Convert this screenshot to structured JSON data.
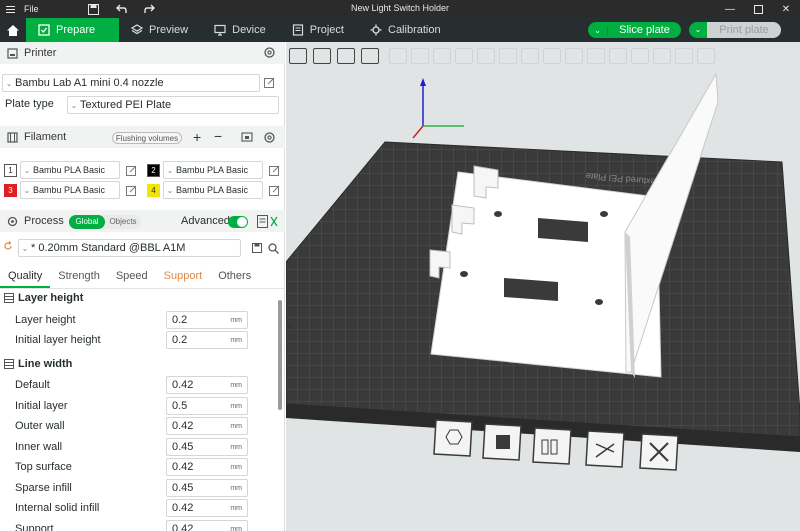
{
  "window": {
    "file_menu": "File",
    "title": "New Light Switch Holder"
  },
  "tabs": [
    {
      "label": "Prepare"
    },
    {
      "label": "Preview"
    },
    {
      "label": "Device"
    },
    {
      "label": "Project"
    },
    {
      "label": "Calibration"
    }
  ],
  "actions": {
    "slice": "Slice plate",
    "print": "Print plate"
  },
  "printer": {
    "section": "Printer",
    "name": "Bambu Lab A1 mini 0.4 nozzle",
    "plate_type_label": "Plate type",
    "plate_type": "Textured PEI Plate"
  },
  "filament": {
    "section": "Filament",
    "flushing": "Flushing volumes",
    "slots": [
      {
        "num": "1",
        "name": "Bambu PLA Basic",
        "color": "#ffffff"
      },
      {
        "num": "2",
        "name": "Bambu PLA Basic",
        "color": "#000000"
      },
      {
        "num": "3",
        "name": "Bambu PLA Basic",
        "color": "#e02020"
      },
      {
        "num": "4",
        "name": "Bambu PLA Basic",
        "color": "#f2e600"
      }
    ]
  },
  "process": {
    "section": "Process",
    "global": "Global",
    "objects": "Objects",
    "advanced": "Advanced",
    "preset": "* 0.20mm Standard @BBL A1M",
    "tabs": [
      "Quality",
      "Strength",
      "Speed",
      "Support",
      "Others"
    ],
    "groups": {
      "layer_height": {
        "title": "Layer height",
        "rows": [
          {
            "label": "Layer height",
            "value": "0.2",
            "unit": "mm"
          },
          {
            "label": "Initial layer height",
            "value": "0.2",
            "unit": "mm"
          }
        ]
      },
      "line_width": {
        "title": "Line width",
        "rows": [
          {
            "label": "Default",
            "value": "0.42",
            "unit": "mm"
          },
          {
            "label": "Initial layer",
            "value": "0.5",
            "unit": "mm"
          },
          {
            "label": "Outer wall",
            "value": "0.42",
            "unit": "mm"
          },
          {
            "label": "Inner wall",
            "value": "0.45",
            "unit": "mm"
          },
          {
            "label": "Top surface",
            "value": "0.42",
            "unit": "mm"
          },
          {
            "label": "Sparse infill",
            "value": "0.45",
            "unit": "mm"
          },
          {
            "label": "Internal solid infill",
            "value": "0.42",
            "unit": "mm"
          },
          {
            "label": "Support",
            "value": "0.42",
            "unit": "mm"
          }
        ]
      }
    }
  },
  "plate": {
    "brand_text": "Bambu Textured PEI Plate"
  },
  "colors": {
    "accent": "#00ae42",
    "titlebar": "#2b2b2b",
    "tabbar": "#262e30",
    "warn_tab": "#e08a48",
    "plate": "#3a3a3a",
    "model": "#ffffff"
  }
}
